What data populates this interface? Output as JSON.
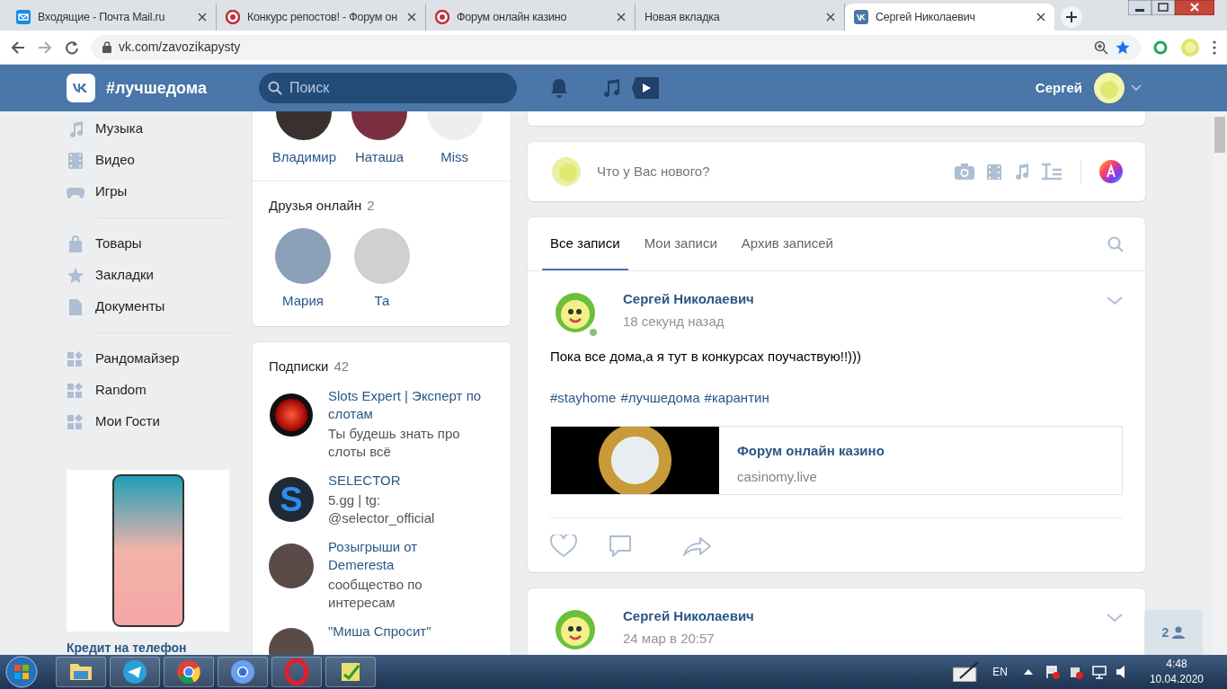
{
  "browser": {
    "tabs": [
      {
        "title": "Входящие - Почта Mail.ru",
        "kind": "mail",
        "selected": false
      },
      {
        "title": "Конкурс репостов! - Форум он",
        "kind": "casino",
        "selected": false
      },
      {
        "title": "Форум онлайн казино",
        "kind": "casino",
        "selected": false
      },
      {
        "title": "Новая вкладка",
        "kind": "blank",
        "selected": false
      },
      {
        "title": "Сергей Николаевич",
        "kind": "vk",
        "selected": true
      }
    ],
    "url": "vk.com/zavozikapysty"
  },
  "header": {
    "hashtag": "#лучшедома",
    "search": {
      "placeholder": "Поиск"
    },
    "user_name": "Сергей"
  },
  "left_menu": {
    "groups": [
      [
        {
          "label": "Музыка",
          "kind": "music"
        },
        {
          "label": "Видео",
          "kind": "film"
        },
        {
          "label": "Игры",
          "kind": "gamepad"
        }
      ],
      [
        {
          "label": "Товары",
          "kind": "bag"
        },
        {
          "label": "Закладки",
          "kind": "star"
        },
        {
          "label": "Документы",
          "kind": "file"
        }
      ],
      [
        {
          "label": "Рандомайзер",
          "kind": "apps"
        },
        {
          "label": "Random",
          "kind": "apps"
        },
        {
          "label": "Мои Гости",
          "kind": "apps"
        }
      ]
    ]
  },
  "ad": {
    "title": "Кредит на телефон"
  },
  "friends": {
    "names": [
      "Владимир",
      "Наташа",
      "Miss"
    ]
  },
  "friends_online": {
    "title": "Друзья онлайн",
    "count": "2",
    "names": [
      "Мария",
      "Та"
    ]
  },
  "subscriptions": {
    "title": "Подписки",
    "count": "42",
    "items": [
      {
        "name": "Slots Expert | Эксперт по слотам",
        "description": "Ты будешь знать про слоты всё",
        "kind": "sphere"
      },
      {
        "name": "SELECTOR",
        "description": "5.gg | tg: @selector_official",
        "kind": "letter",
        "avatar_letter": "S"
      },
      {
        "name": "Розыгрыши от Demeresta",
        "description": "сообщество по интересам",
        "kind": "photo"
      },
      {
        "name": "\"Миша Спросит\"",
        "kind": "photo"
      }
    ]
  },
  "composer": {
    "placeholder": "Что у Вас нового?"
  },
  "wall_tabs": [
    {
      "label": "Все записи",
      "selected": true
    },
    {
      "label": "Мои записи",
      "selected": false
    },
    {
      "label": "Архив записей",
      "selected": false
    }
  ],
  "posts": [
    {
      "author": "Сергей Николаевич",
      "time": "18 секунд назад",
      "online": true,
      "text": "Пока все дома,а я тут в конкурсах поучаствую!!)))",
      "hashtags": [
        "#stayhome",
        "#лучшедома",
        "#карантин"
      ],
      "link": {
        "title": "Форум онлайн казино",
        "domain": "casinomy.live"
      }
    },
    {
      "author": "Сергей Николаевич",
      "time": "24 мар в 20:57",
      "online": false
    }
  ],
  "online_badge": {
    "count": "2"
  },
  "taskbar": {
    "language": "EN",
    "time": "4:48",
    "date": "10.04.2020"
  }
}
